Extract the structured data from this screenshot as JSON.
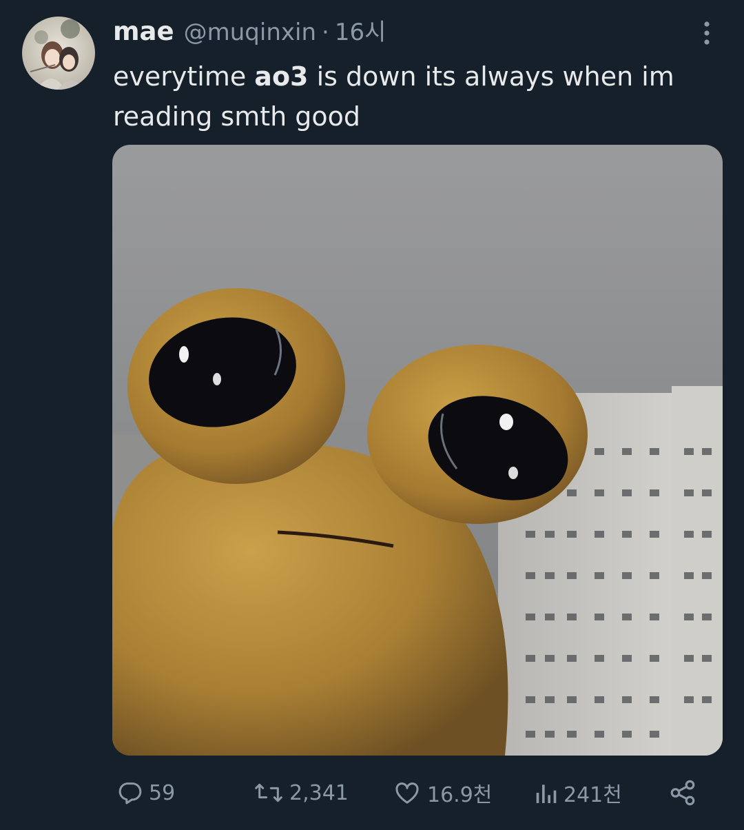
{
  "tweet": {
    "display_name": "mae",
    "handle": "@muqinxin",
    "separator": "·",
    "time": "16시",
    "text_before": "everytime ",
    "text_bold": "ao3",
    "text_after": " is down its always when im reading smth good"
  },
  "actions": {
    "replies": "59",
    "retweets": "2,341",
    "likes": "16.9천",
    "views": "241천"
  },
  "icons": {
    "more": "more-vertical-icon",
    "reply": "reply-icon",
    "retweet": "retweet-icon",
    "like": "heart-icon",
    "views": "views-icon",
    "share": "share-icon"
  },
  "colors": {
    "background": "#15202b",
    "text": "#e7e9ea",
    "secondary": "#8b98a5"
  }
}
